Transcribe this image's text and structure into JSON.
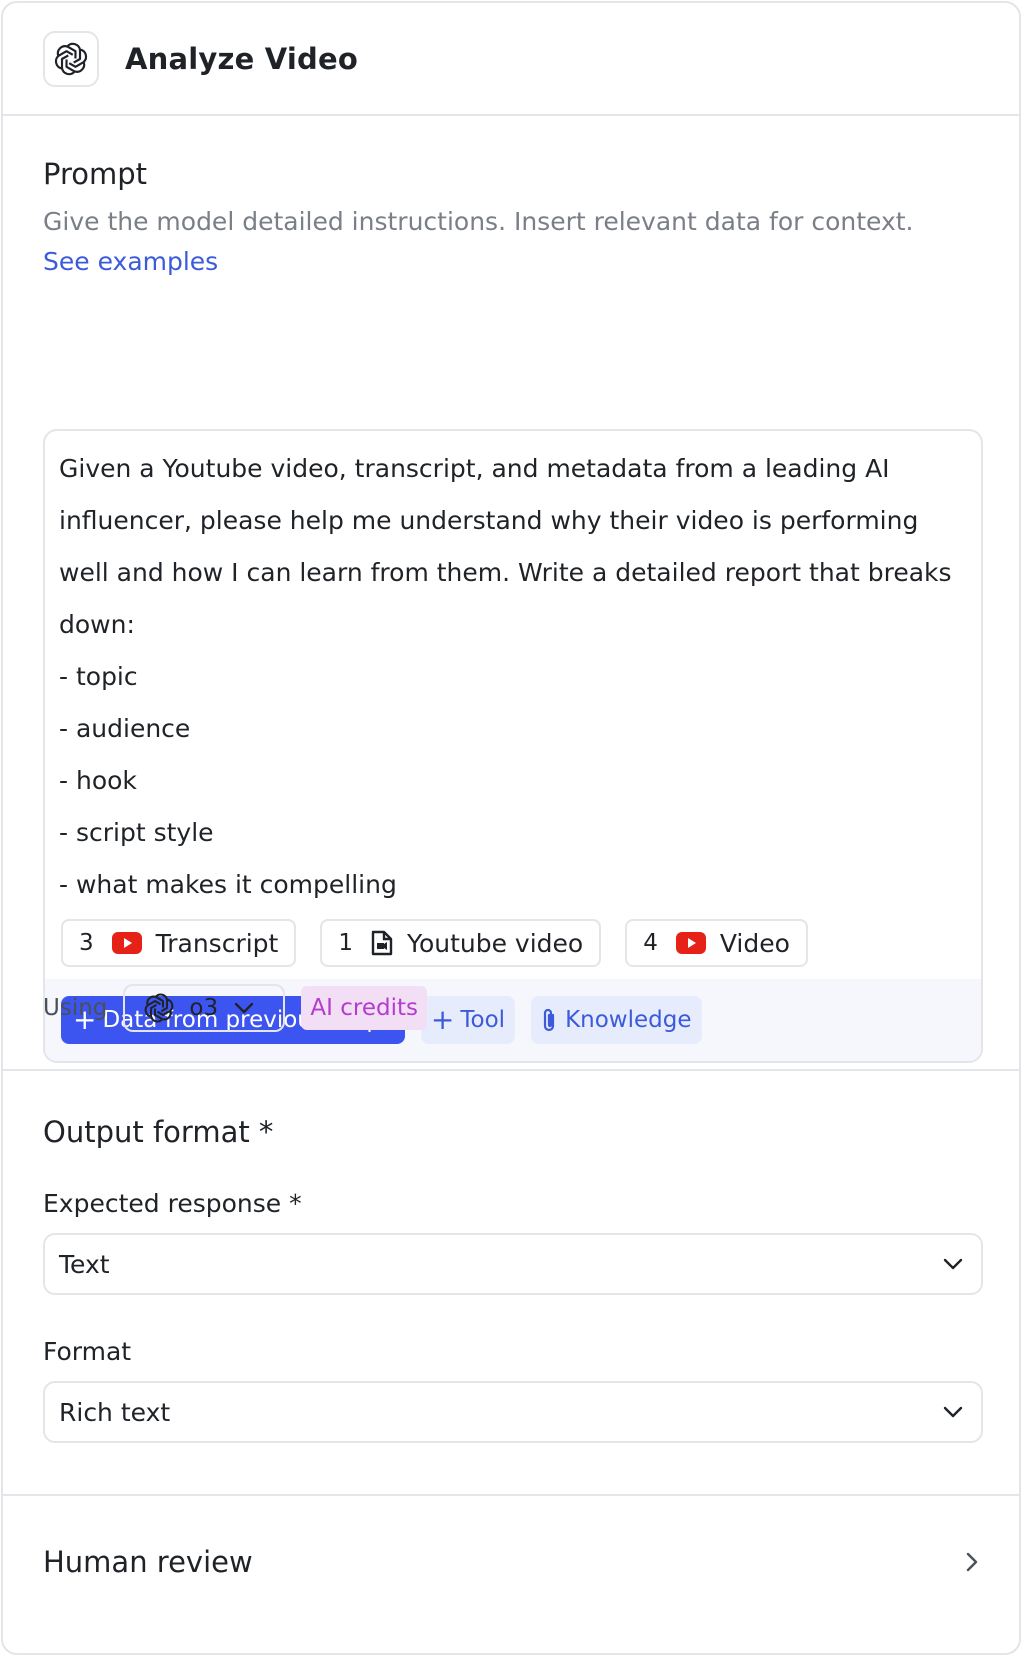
{
  "header": {
    "title": "Analyze Video",
    "logo_icon": "openai-logo-icon"
  },
  "prompt": {
    "title": "Prompt",
    "description": "Give the model detailed instructions. Insert relevant data for context.",
    "examples_link": "See examples",
    "text_lines": [
      "Given a Youtube video, transcript, and metadata from a leading AI",
      "influencer, please help me understand why their video is performing",
      "well and how I can learn from them. Write a detailed report that breaks",
      "down:",
      "- topic",
      "- audience",
      "- hook",
      "- script style",
      "- what makes it compelling"
    ],
    "chips": [
      {
        "num": "3",
        "icon": "youtube-icon",
        "label": "Transcript"
      },
      {
        "num": "1",
        "icon": "file-icon",
        "label": "Youtube video"
      },
      {
        "num": "4",
        "icon": "youtube-icon",
        "label": "Video"
      }
    ],
    "actions": {
      "data_button": "Data from previous steps",
      "tool_button": "Tool",
      "knowledge_button": "Knowledge"
    }
  },
  "model": {
    "using_label": "Using",
    "name": "o3",
    "credits_badge": "AI credits"
  },
  "output_format": {
    "title": "Output format *",
    "expected_label": "Expected response *",
    "expected_value": "Text",
    "format_label": "Format",
    "format_value": "Rich text"
  },
  "human_review": {
    "title": "Human review"
  },
  "colors": {
    "accent": "#3d55f0",
    "link": "#3b5bdb",
    "youtube_red": "#e62117",
    "credits_bg": "#f2dff6",
    "credits_text": "#b43ccf",
    "border": "#e3e5e8"
  }
}
